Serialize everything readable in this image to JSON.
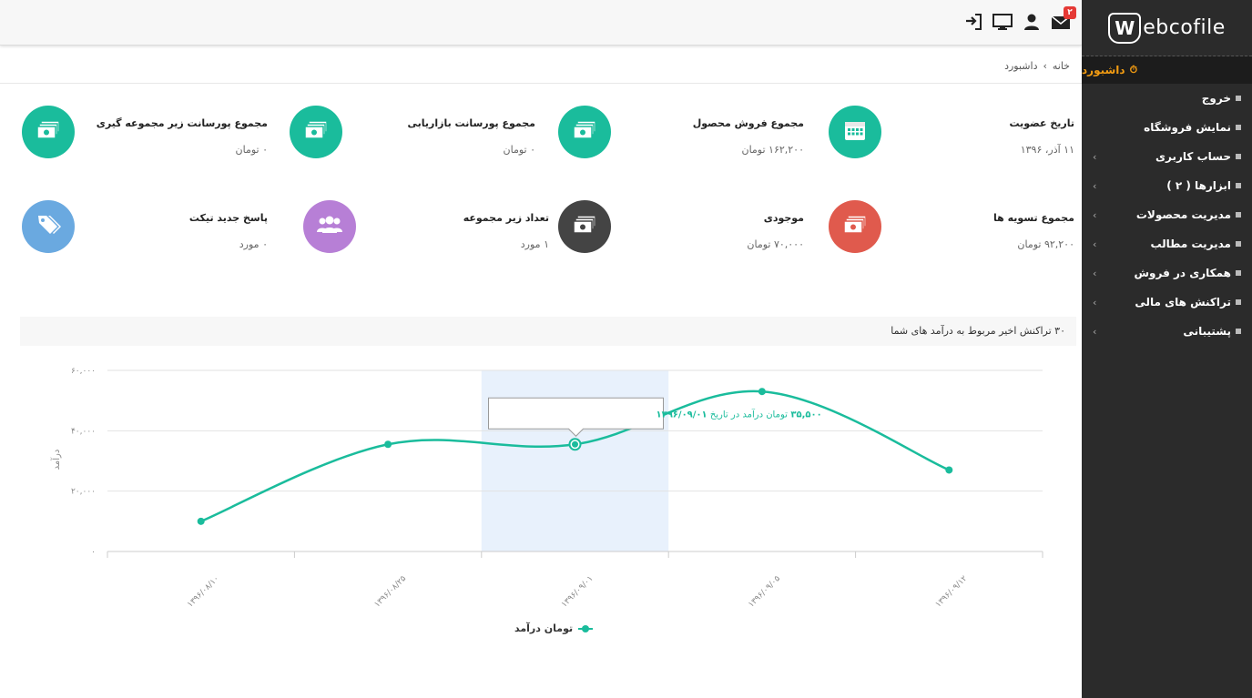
{
  "logo": {
    "text": "ebcofile",
    "mark": "W"
  },
  "sidebar": {
    "active": {
      "label": "داشبورد"
    },
    "items": [
      {
        "label": "خروج",
        "chevron": false
      },
      {
        "label": "نمایش فروشگاه",
        "chevron": false
      },
      {
        "label": "حساب کاربری",
        "chevron": true
      },
      {
        "label": "ابزارها ( ۲ )",
        "chevron": true
      },
      {
        "label": "مدیریت محصولات",
        "chevron": true
      },
      {
        "label": "مدیریت مطالب",
        "chevron": true
      },
      {
        "label": "همکاری در فروش",
        "chevron": true
      },
      {
        "label": "تراکنش های مالی",
        "chevron": true
      },
      {
        "label": "پشتیبانی",
        "chevron": true
      }
    ]
  },
  "topbar": {
    "messages_badge": "۲"
  },
  "breadcrumb": {
    "home": "خانه",
    "separator": "›",
    "current": "داشبورد"
  },
  "stats": {
    "membership": {
      "title": "تاریخ عضویت",
      "value": "۱۱ آذر، ۱۳۹۶",
      "color": "#1abc9c",
      "icon": "calendar-icon"
    },
    "sales": {
      "title": "مجموع فروش محصول",
      "value": "۱۶۲,۲۰۰ تومان",
      "color": "#1abc9c",
      "icon": "money-icon"
    },
    "marketing": {
      "title": "مجموع پورسانت بازاریابی",
      "value": "۰ تومان",
      "color": "#1abc9c",
      "icon": "money-icon"
    },
    "sub_commission": {
      "title": "مجموع پورسانت زیر مجموعه گیری",
      "value": "۰ تومان",
      "color": "#1abc9c",
      "icon": "money-icon"
    },
    "settlements": {
      "title": "مجموع تسویه ها",
      "value": "۹۲,۲۰۰ تومان",
      "color": "#e05a4d",
      "icon": "money-icon"
    },
    "balance": {
      "title": "موجودی",
      "value": "۷۰,۰۰۰ تومان",
      "color": "#444444",
      "icon": "money-icon"
    },
    "subsets": {
      "title": "تعداد زیر مجموعه",
      "value": "۱ مورد",
      "color": "#b77fd6",
      "icon": "users-icon"
    },
    "tickets": {
      "title": "پاسخ جدید تیکت",
      "value": "۰ مورد",
      "color": "#6aa9e0",
      "icon": "tag-icon"
    }
  },
  "chart_panel": {
    "title": "۳۰ تراکنش اخیر مربوط به درآمد های شما"
  },
  "chart_data": {
    "type": "line",
    "categories": [
      "۱۳۹۶/۰۸/۱۰",
      "۱۳۹۶/۰۸/۲۵",
      "۱۳۹۶/۰۹/۰۱",
      "۱۳۹۶/۰۹/۰۵",
      "۱۳۹۶/۰۹/۱۲"
    ],
    "series": [
      {
        "name": "تومان درآمد",
        "values": [
          10000,
          35500,
          35500,
          53000,
          27000
        ],
        "color": "#1abc9c"
      }
    ],
    "ylabel": "درآمد",
    "ylim": [
      0,
      60000
    ],
    "yticks": [
      0,
      20000,
      40000,
      60000
    ],
    "ytick_labels": [
      "۰",
      "۲۰,۰۰۰",
      "۴۰,۰۰۰",
      "۶۰,۰۰۰"
    ],
    "grid": true,
    "highlight_index": 2,
    "tooltip": {
      "value": "۳۵,۵۰۰",
      "text": "تومان درآمد در تاریخ",
      "date": "۱۳۹۶/۰۹/۰۱"
    },
    "legend": "bottom-center"
  }
}
